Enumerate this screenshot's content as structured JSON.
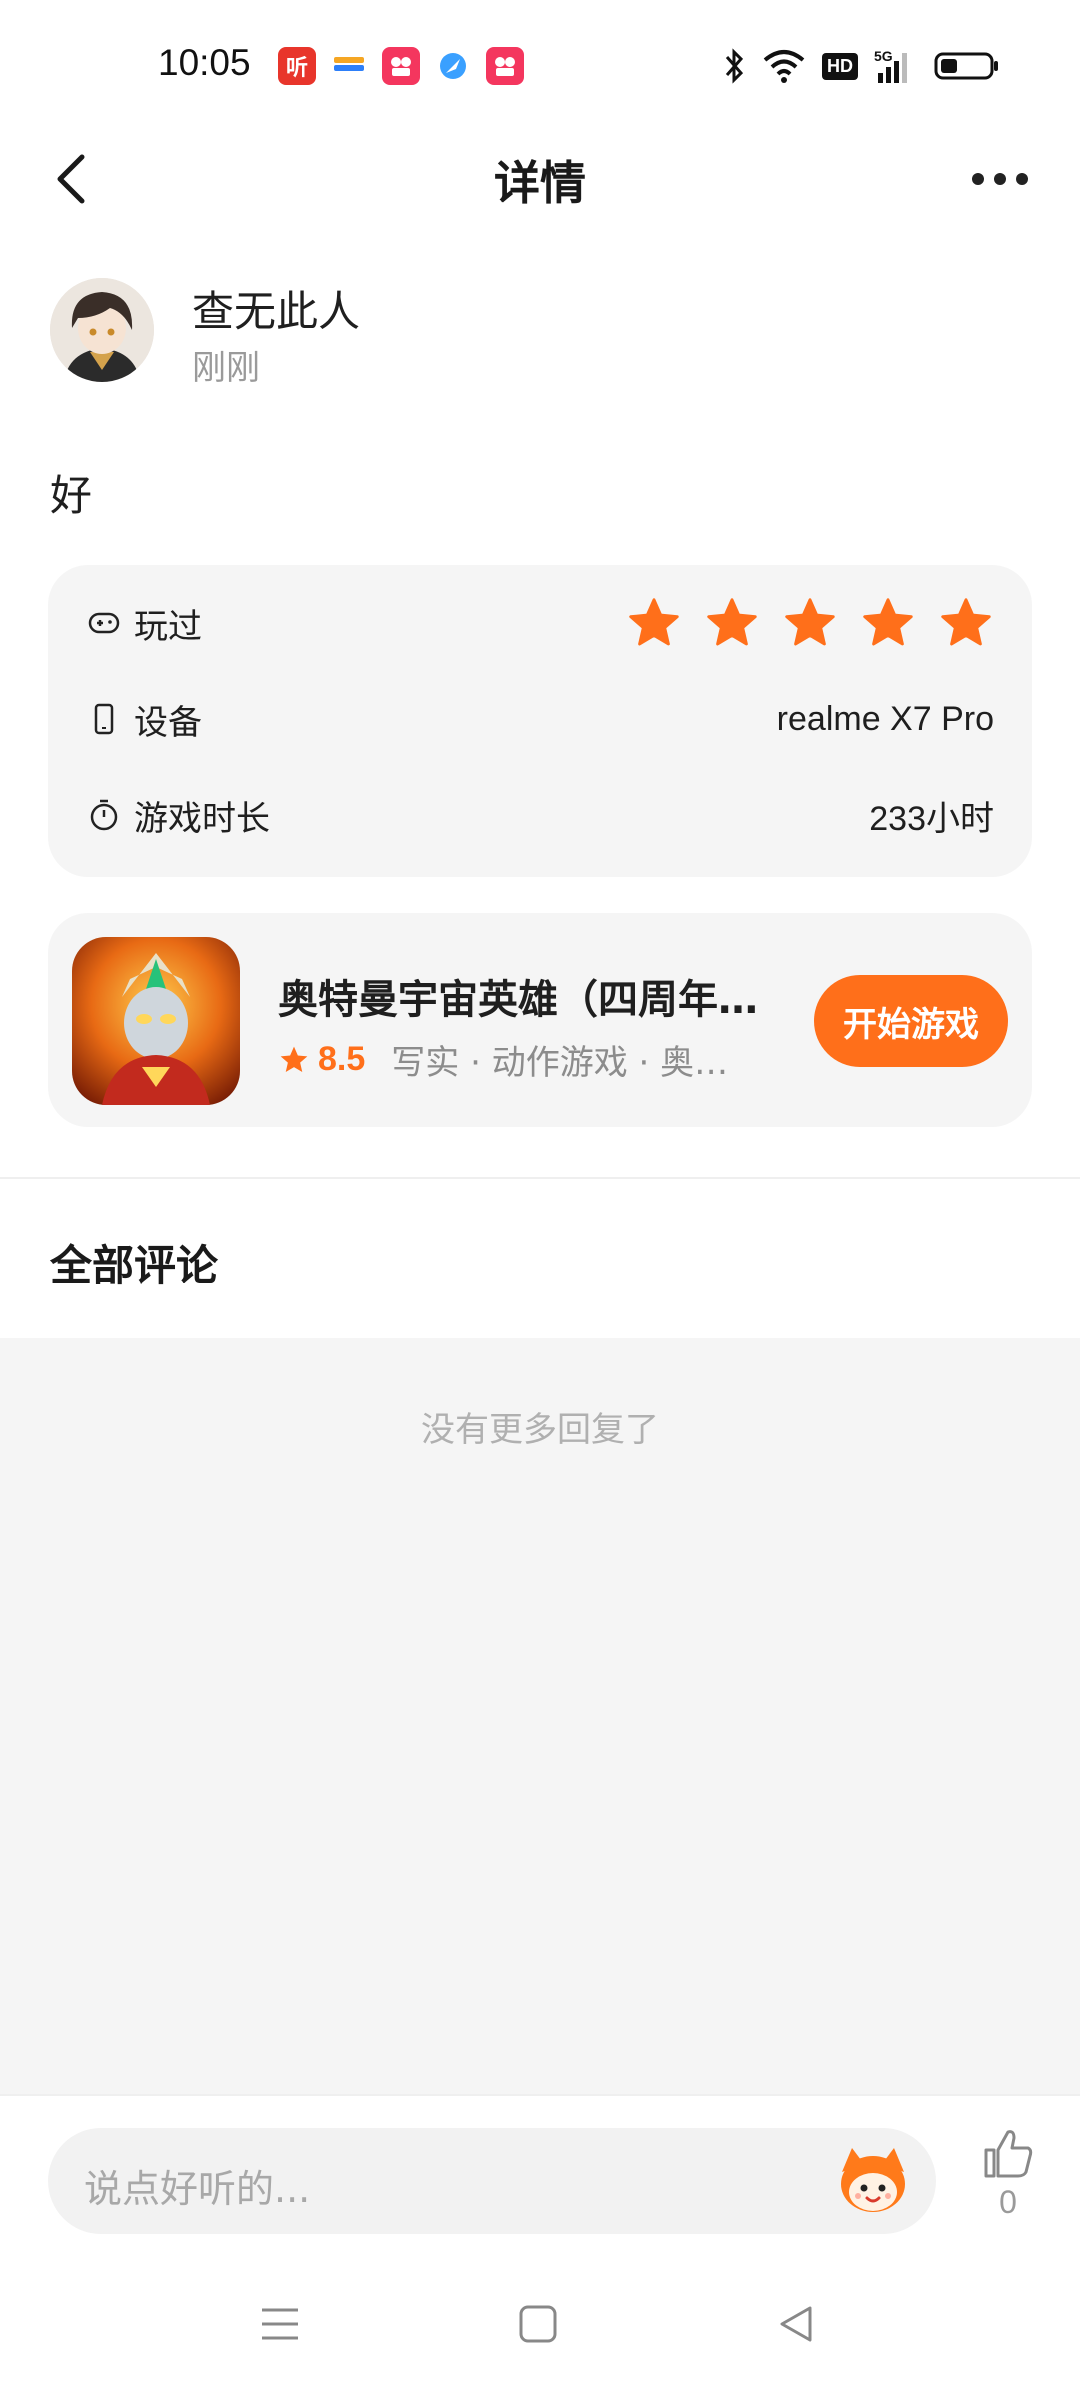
{
  "status_bar": {
    "time": "10:05",
    "notification_icons": [
      "listen-app-icon",
      "wallet-app-icon",
      "video-app-icon",
      "browser-app-icon",
      "video-app-icon"
    ],
    "hd_label": "HD"
  },
  "header": {
    "title": "详情"
  },
  "author": {
    "name": "查无此人",
    "time": "刚刚"
  },
  "post": {
    "text": "好"
  },
  "info": {
    "played_label": "玩过",
    "rating_stars": 5,
    "device_label": "设备",
    "device_value": "realme X7 Pro",
    "playtime_label": "游戏时长",
    "playtime_value": "233小时"
  },
  "game": {
    "title": "奥特曼宇宙英雄（四周年…",
    "rating": "8.5",
    "tags": "写实 · 动作游戏 · 奥特…",
    "play_label": "开始游戏"
  },
  "comments": {
    "section_title": "全部评论",
    "empty_text": "没有更多回复了"
  },
  "bottom": {
    "input_placeholder": "说点好听的...",
    "like_count": "0"
  },
  "colors": {
    "accent": "#ff6f1a",
    "card_bg": "#f5f5f5"
  }
}
